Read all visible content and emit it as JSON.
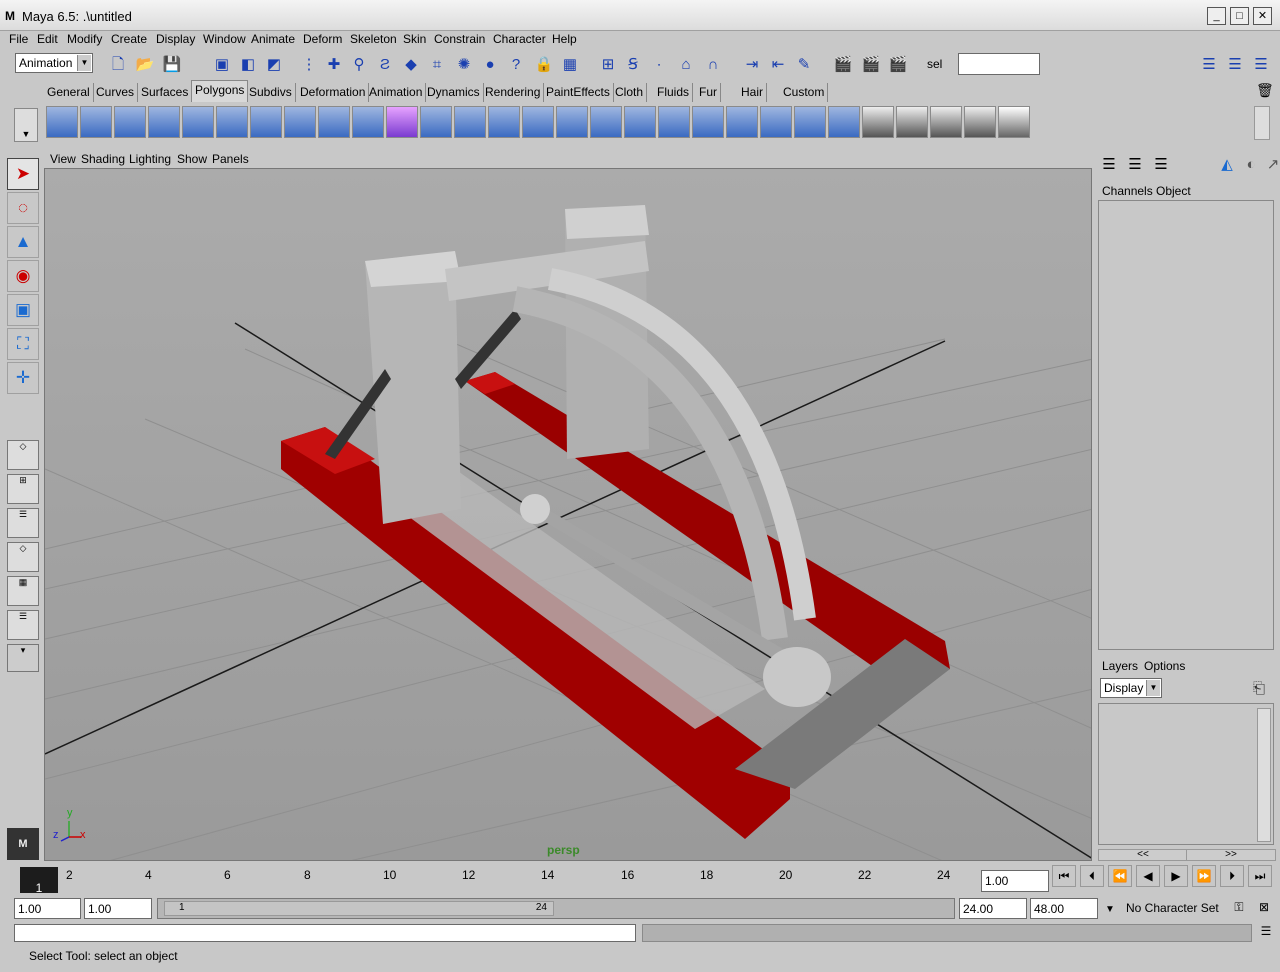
{
  "window": {
    "title": "Maya 6.5: .\\untitled",
    "logo": "M"
  },
  "menu": [
    "File",
    "Edit",
    "Modify",
    "Create",
    "Display",
    "Window",
    "Animate",
    "Deform",
    "Skeleton",
    "Skin",
    "Constrain",
    "Character",
    "Help"
  ],
  "status": {
    "menu_set": "Animation",
    "sel_label": "sel",
    "sel_value": ""
  },
  "shelf_tabs": [
    "General",
    "Curves",
    "Surfaces",
    "Polygons",
    "Subdivs",
    "Deformation",
    "Animation",
    "Dynamics",
    "Rendering",
    "PaintEffects",
    "Cloth",
    "Fluids",
    "Fur",
    "Hair",
    "Custom"
  ],
  "active_tab": "Polygons",
  "panel_menu": [
    "View",
    "Shading",
    "Lighting",
    "Show",
    "Panels"
  ],
  "viewport": {
    "camera": "persp",
    "axis_y": "y",
    "axis_z": "z",
    "axis_x": "x"
  },
  "channel_box": {
    "menu": [
      "Channels",
      "Object"
    ]
  },
  "layer_editor": {
    "menu": [
      "Layers",
      "Options"
    ],
    "mode": "Display",
    "nav_prev": "<<",
    "nav_next": ">>"
  },
  "time": {
    "current_frame_marker": "1",
    "ticks": [
      "2",
      "4",
      "6",
      "8",
      "10",
      "12",
      "14",
      "16",
      "18",
      "20",
      "22",
      "24"
    ],
    "current_time": "1.00",
    "start_time": "1.00",
    "playback_start": "1.00",
    "range_start_label": "1",
    "range_end_label": "24",
    "playback_end": "24.00",
    "end_time": "48.00",
    "character_set": "No Character Set"
  },
  "help_line": "Select Tool: select an object",
  "colors": {
    "background": "#c8c8c8",
    "viewport": "#a3a3a3",
    "red_part": "#b00000",
    "persp_label": "#3b8a2a"
  }
}
